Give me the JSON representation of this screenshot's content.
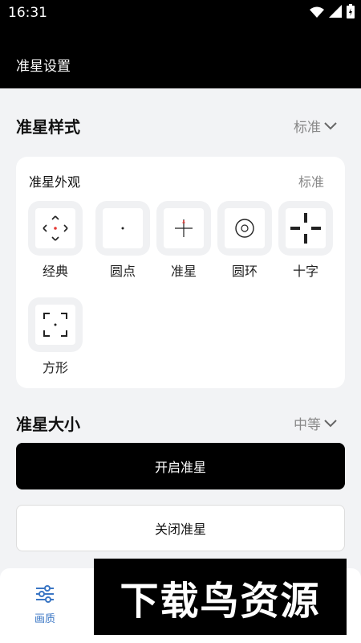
{
  "status_bar": {
    "time": "16:31",
    "icons": [
      "wifi-icon",
      "signal-icon",
      "battery-icon"
    ]
  },
  "app_bar": {
    "title": "准星设置"
  },
  "crosshair_style": {
    "label": "准星样式",
    "selected": "标准"
  },
  "appearance_card": {
    "title": "准星外观",
    "value": "标准",
    "items": [
      {
        "label": "经典",
        "icon": "classic-crosshair-icon"
      },
      {
        "label": "圆点",
        "icon": "dot-crosshair-icon"
      },
      {
        "label": "准星",
        "icon": "cross-crosshair-icon"
      },
      {
        "label": "圆环",
        "icon": "ring-crosshair-icon"
      },
      {
        "label": "十字",
        "icon": "plus-crosshair-icon"
      },
      {
        "label": "方形",
        "icon": "square-crosshair-icon"
      }
    ]
  },
  "crosshair_size": {
    "label": "准星大小",
    "selected": "中等"
  },
  "buttons": {
    "enable_label": "开启准星",
    "disable_label": "关闭准星"
  },
  "bottom_nav": {
    "items": [
      {
        "label": "画质",
        "icon": "sliders-icon"
      }
    ]
  },
  "watermark": {
    "text": "下载鸟资源"
  },
  "colors": {
    "accent_blue": "#3a76c4",
    "crosshair_red": "#e53935",
    "background": "#f2f3f5"
  }
}
